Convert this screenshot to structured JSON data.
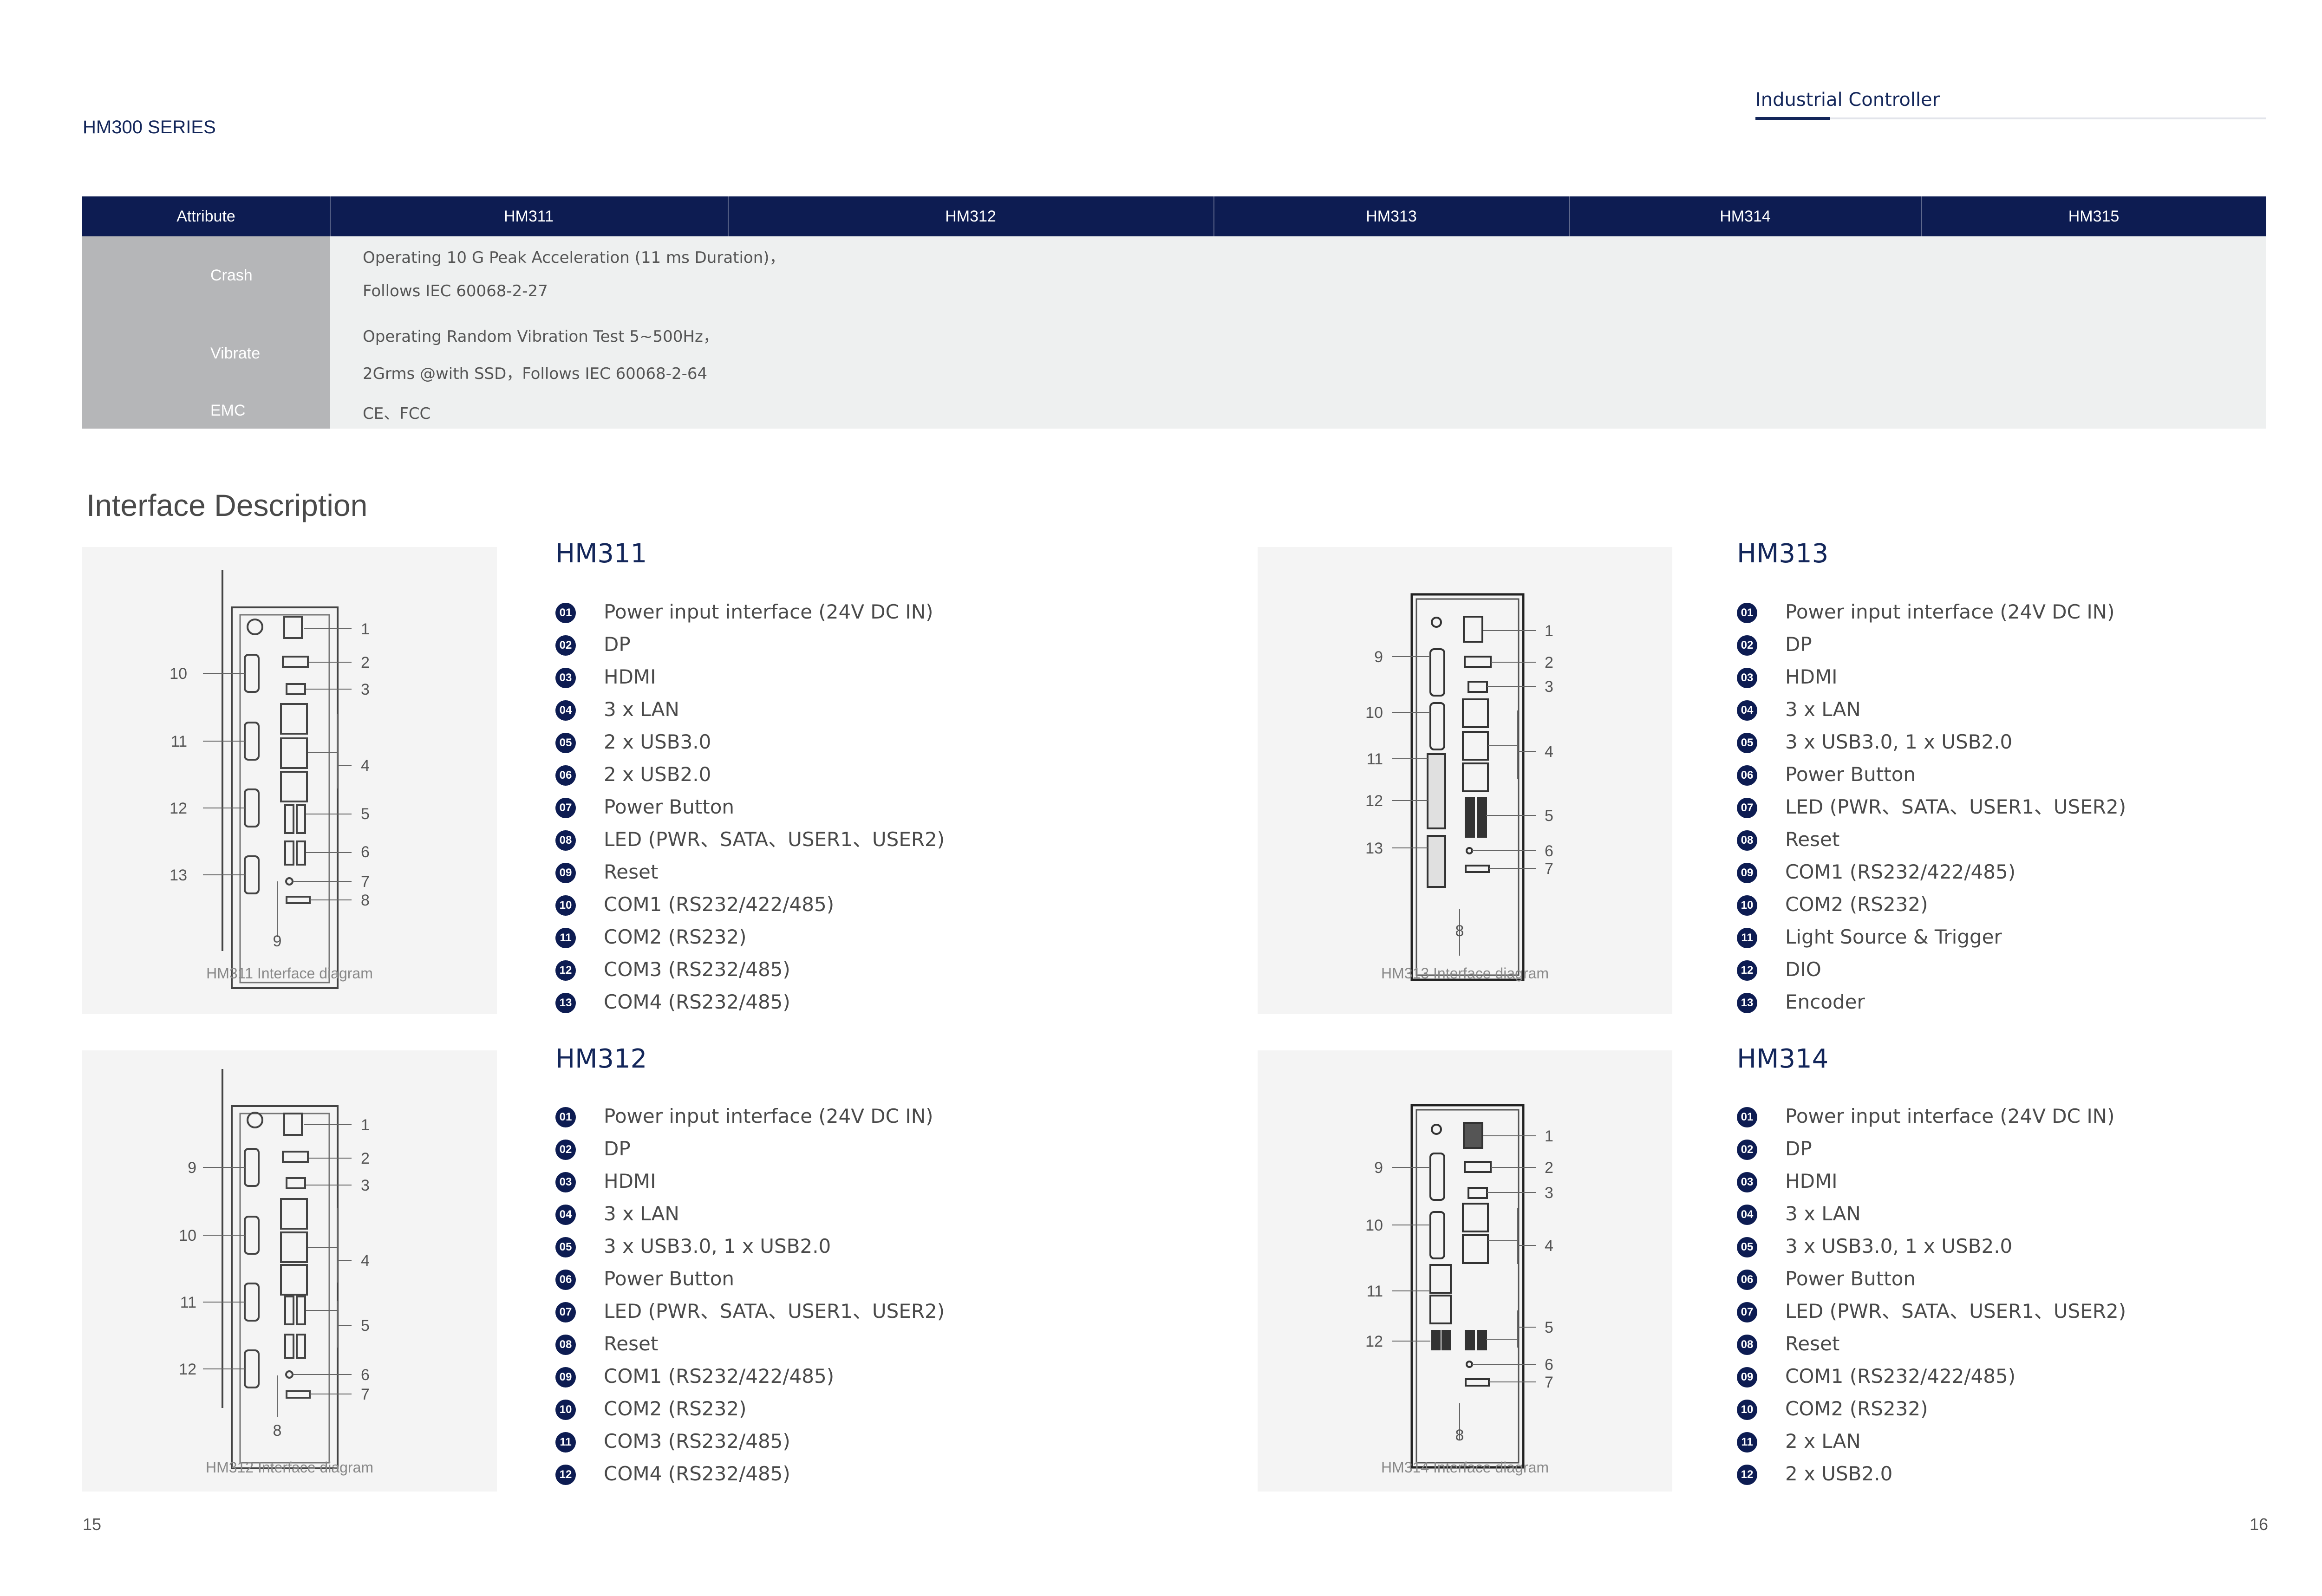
{
  "header": {
    "series": "HM300 SERIES",
    "category": "Industrial Controller"
  },
  "spec_table": {
    "columns": [
      "Attribute",
      "HM311",
      "HM312",
      "HM313",
      "HM314",
      "HM315"
    ],
    "rows": [
      {
        "label": "Crash",
        "lines": [
          "Operating 10 G Peak Acceleration (11 ms Duration)，",
          "Follows IEC 60068-2-27"
        ]
      },
      {
        "label": "Vibrate",
        "lines": [
          "Operating Random Vibration Test 5~500Hz，",
          "2Grms @with SSD，Follows IEC 60068-2-64"
        ]
      },
      {
        "label": "EMC",
        "lines": [
          "CE、FCC"
        ]
      }
    ]
  },
  "section_title": "Interface Description",
  "models": [
    {
      "name": "HM311",
      "caption": "HM311 Interface diagram",
      "items": [
        "Power input interface (24V DC IN)",
        "DP",
        "HDMI",
        "3 x LAN",
        "2 x USB3.0",
        "2 x USB2.0",
        "Power Button",
        "LED (PWR、SATA、USER1、USER2)",
        "Reset",
        "COM1 (RS232/422/485)",
        "COM2 (RS232)",
        "COM3 (RS232/485)",
        "COM4 (RS232/485)"
      ],
      "diagram_labels": {
        "right": [
          "1",
          "2",
          "3",
          "4",
          "5",
          "6",
          "7",
          "8"
        ],
        "left": [
          "10",
          "11",
          "12",
          "13"
        ],
        "bottom": "9"
      }
    },
    {
      "name": "HM312",
      "caption": "HM312 Interface diagram",
      "items": [
        "Power input interface (24V DC IN)",
        "DP",
        "HDMI",
        "3 x LAN",
        "3 x USB3.0, 1 x USB2.0",
        "Power Button",
        "LED (PWR、SATA、USER1、USER2)",
        "Reset",
        "COM1 (RS232/422/485)",
        "COM2 (RS232)",
        "COM3 (RS232/485)",
        "COM4 (RS232/485)"
      ],
      "diagram_labels": {
        "right": [
          "1",
          "2",
          "3",
          "4",
          "5",
          "6",
          "7"
        ],
        "left": [
          "9",
          "10",
          "11",
          "12"
        ],
        "bottom": "8"
      }
    },
    {
      "name": "HM313",
      "caption": "HM313 Interface diagram",
      "items": [
        "Power input interface (24V DC IN)",
        "DP",
        "HDMI",
        "3 x LAN",
        "3 x USB3.0, 1 x USB2.0",
        "Power Button",
        "LED (PWR、SATA、USER1、USER2)",
        "Reset",
        "COM1 (RS232/422/485)",
        "COM2 (RS232)",
        "Light Source & Trigger",
        "DIO",
        "Encoder"
      ],
      "diagram_labels": {
        "right": [
          "1",
          "2",
          "3",
          "4",
          "5",
          "6",
          "7"
        ],
        "left": [
          "9",
          "10",
          "11",
          "12",
          "13"
        ],
        "bottom": "8"
      }
    },
    {
      "name": "HM314",
      "caption": "HM314 Interface diagram",
      "items": [
        "Power input interface (24V DC IN)",
        "DP",
        "HDMI",
        "3 x LAN",
        "3 x USB3.0, 1 x USB2.0",
        "Power Button",
        "LED (PWR、SATA、USER1、USER2)",
        "Reset",
        "COM1 (RS232/422/485)",
        "COM2 (RS232)",
        "2 x LAN",
        "2 x USB2.0"
      ],
      "diagram_labels": {
        "right": [
          "1",
          "2",
          "3",
          "4",
          "5",
          "6",
          "7"
        ],
        "left": [
          "9",
          "10",
          "11",
          "12"
        ],
        "bottom": "8"
      }
    }
  ],
  "page_numbers": {
    "left": "15",
    "right": "16"
  }
}
